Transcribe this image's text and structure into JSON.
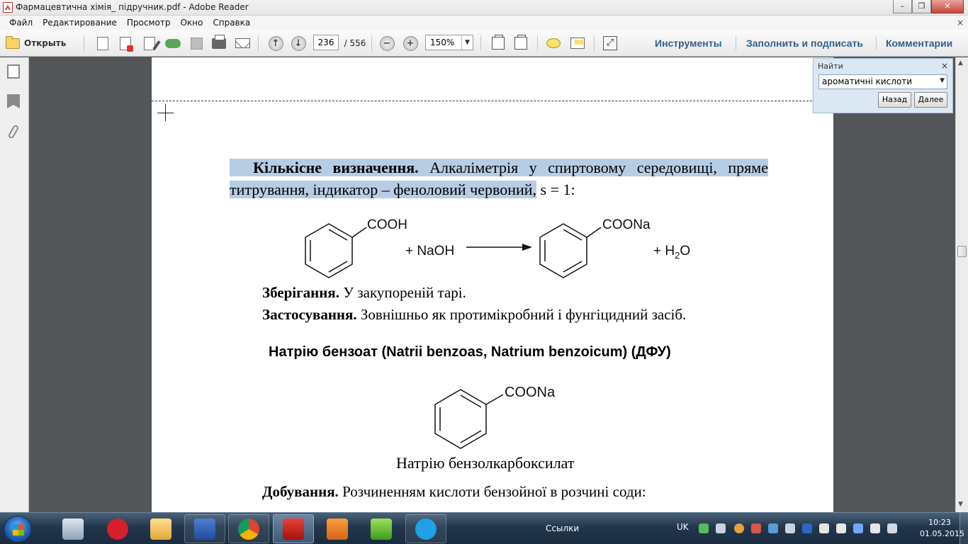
{
  "window": {
    "title": "Фармацевтична хімія_ підручник.pdf - Adobe Reader"
  },
  "menu": {
    "items": [
      "Файл",
      "Редактирование",
      "Просмотр",
      "Окно",
      "Справка"
    ],
    "close_glyph": "×"
  },
  "toolbar": {
    "open_label": "Открыть",
    "page_current": "236",
    "page_total": "/ 556",
    "zoom": "150%",
    "tools_label": "Инструменты",
    "fill_sign_label": "Заполнить и подписать",
    "comments_label": "Комментарии"
  },
  "find": {
    "title": "Найти",
    "query": "ароматичні кислоти",
    "back_label": "Назад",
    "next_label": "Далее"
  },
  "document": {
    "para1_bold": "Кількісне визначення.",
    "para1_rest": " Алкаліметрія у спиртовому середовищі, пряме титрування, індикатор – феноловий червоний,",
    "para1_tail": " s = 1:",
    "reaction": {
      "reactant_group": "COOH",
      "reagent": "+ NaOH",
      "product_group": "COONa",
      "byproduct_prefix": "+ H",
      "byproduct_sub": "2",
      "byproduct_suffix": "O"
    },
    "storage_bold": "Зберігання.",
    "storage_text": " У закупореній тарі.",
    "usage_bold": "Застосування.",
    "usage_text": " Зовнішньо як протимікробний і фунгіцидний засіб.",
    "heading": "Натрію бензоат (Natrii benzoas, Natrium benzoicum) (ДФУ)",
    "structure_group": "COONa",
    "caption": "Натрію  бензолкарбоксилат",
    "obtain_bold": "Добування.",
    "obtain_text": " Розчиненням кислоти бензойної в розчині соди:"
  },
  "taskbar": {
    "links_label": "Ссылки",
    "language": "UK",
    "time": "10:23",
    "date": "01.05.2015"
  },
  "colors": {
    "selection_highlight": "#b6cde4",
    "toolbar_link": "#2f5f8f",
    "find_panel": "#dbe7f3"
  }
}
